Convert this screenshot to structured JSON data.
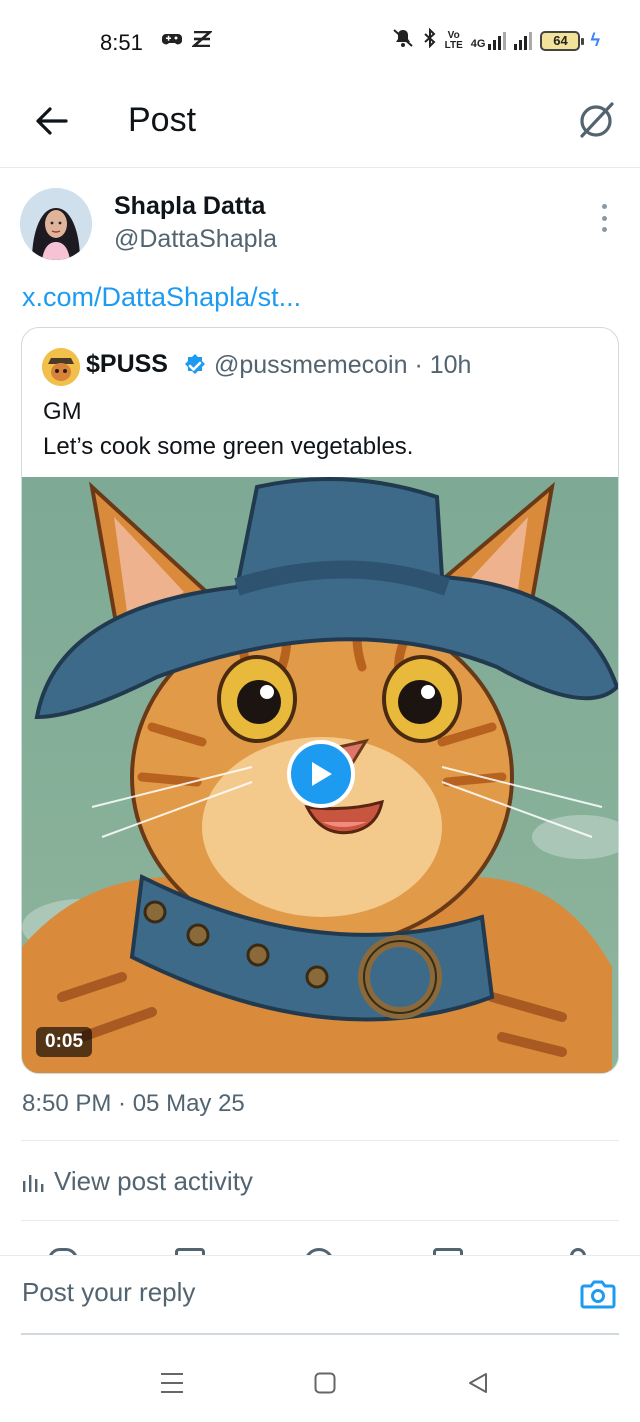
{
  "status_bar": {
    "time": "8:51",
    "left_icons": [
      "game-controller-icon",
      "app-icon"
    ],
    "right_icons": [
      "mute-icon",
      "bluetooth-icon",
      "volte-icon",
      "signal-4g-icon",
      "signal-icon",
      "battery-icon",
      "charging-icon"
    ],
    "volte_line1": "VoLTE",
    "network": "4G",
    "battery": "64"
  },
  "header": {
    "title": "Post",
    "back_icon": "arrow-left-icon",
    "grok_icon": "grok-icon"
  },
  "post": {
    "author_name": "Shapla Datta",
    "author_handle": "@DattaShapla",
    "link_text": "x.com/DattaShapla/st...",
    "timestamp": "8:50 PM · 05 May 25",
    "activity_label": "View post activity"
  },
  "quote": {
    "name": "$PUSS",
    "handle_time": "@pussmemecoin · 10h",
    "text_line1": "GM",
    "text_line2": "Let’s cook some green vegetables.",
    "video_duration": "0:05"
  },
  "reply": {
    "placeholder": "Post your reply"
  },
  "colors": {
    "accent": "#1d9bf0",
    "secondary_text": "#536471",
    "border": "#cfd9de"
  }
}
